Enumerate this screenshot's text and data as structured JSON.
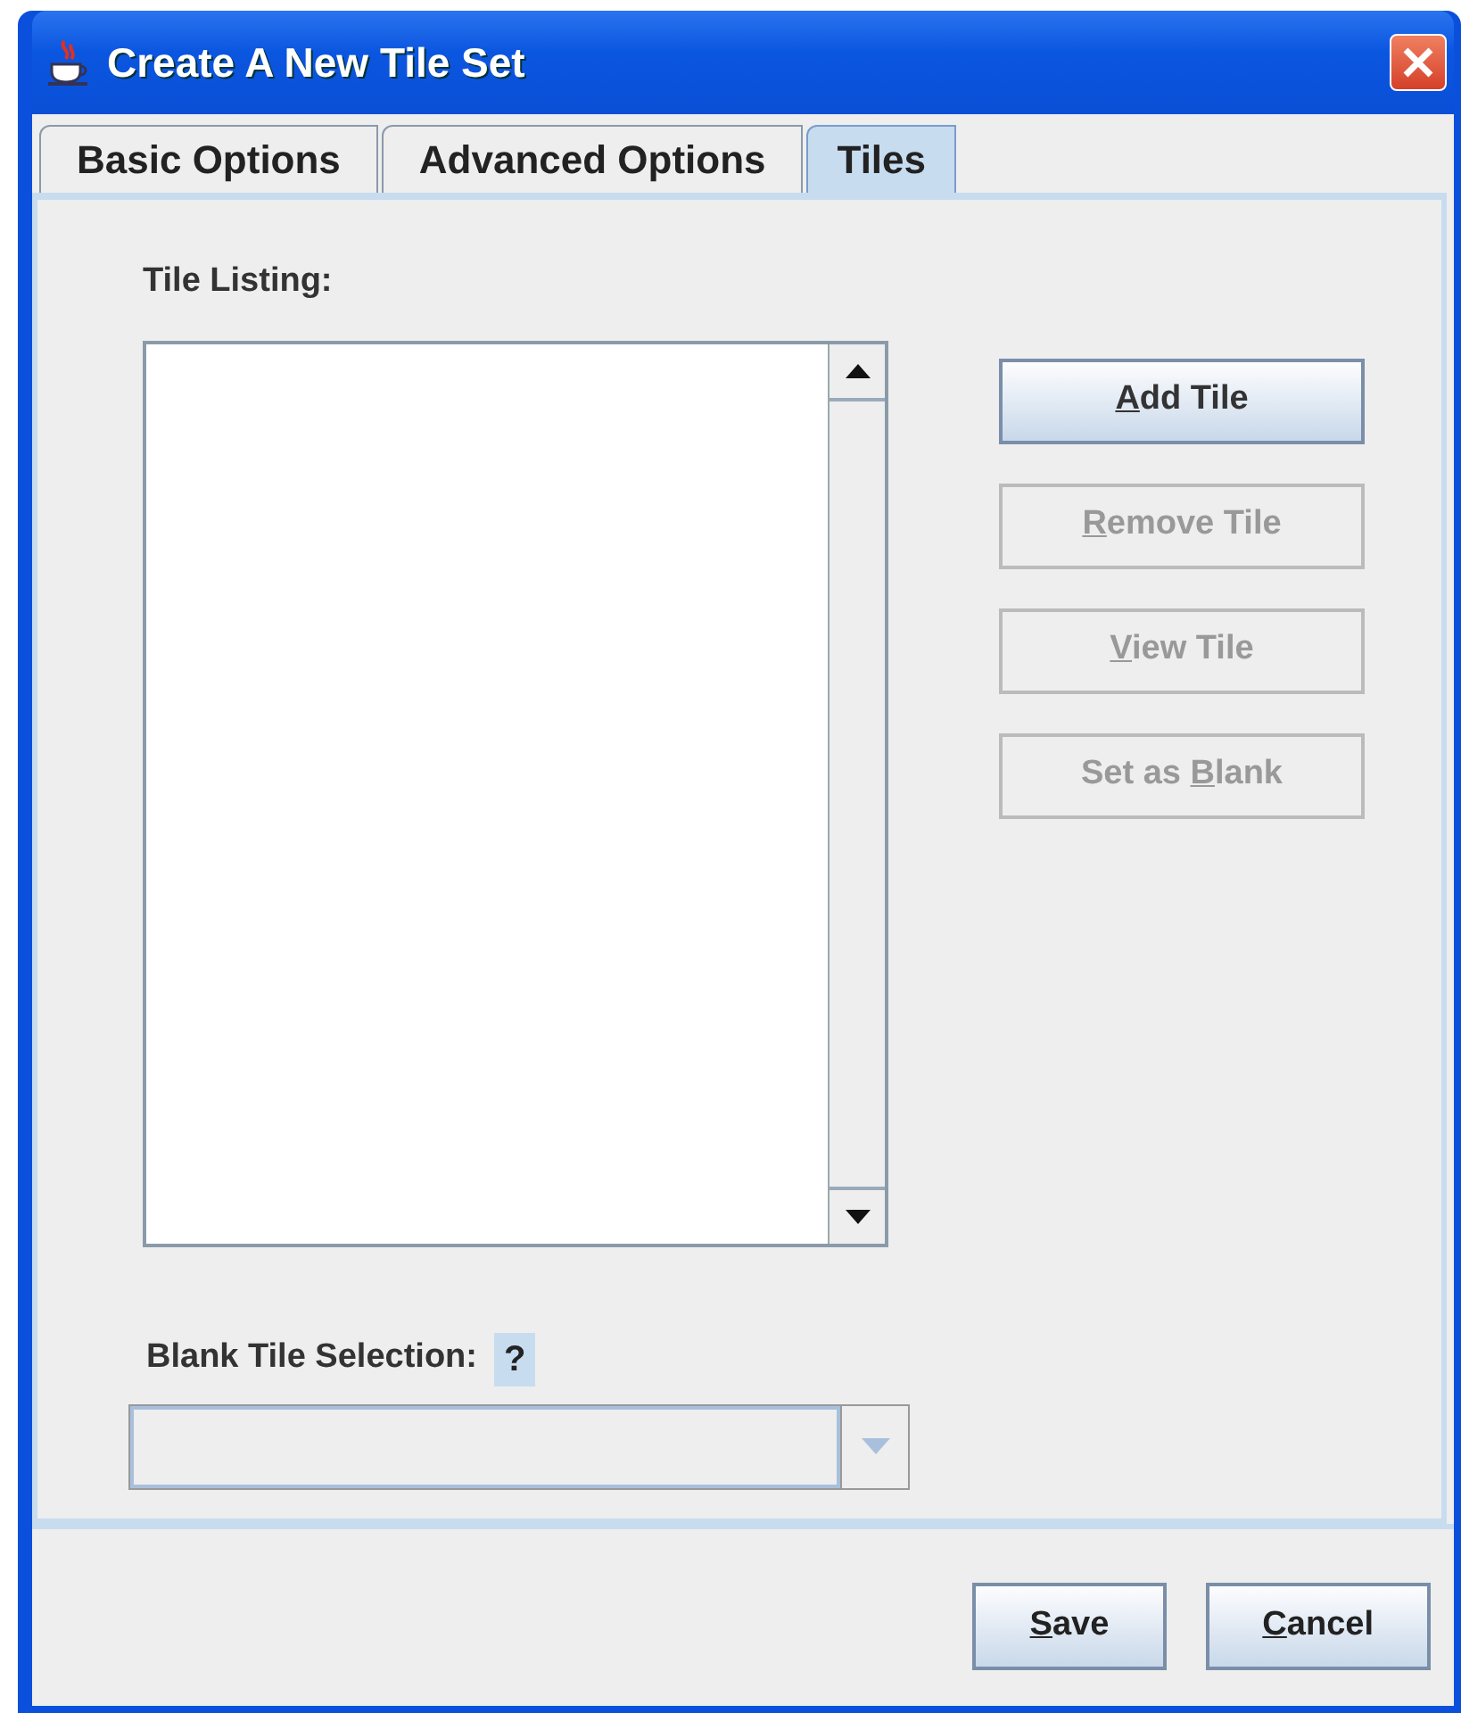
{
  "window": {
    "title": "Create A New Tile Set"
  },
  "tabs": [
    {
      "label": "Basic Options",
      "selected": false
    },
    {
      "label": "Advanced Options",
      "selected": false
    },
    {
      "label": "Tiles",
      "selected": true
    }
  ],
  "tile_listing": {
    "label": "Tile Listing:"
  },
  "side_buttons": [
    {
      "label": {
        "key": "A",
        "post": "dd Tile"
      },
      "disabled": false
    },
    {
      "label": {
        "key": "R",
        "post": "emove Tile"
      },
      "disabled": true
    },
    {
      "label": {
        "key": "V",
        "post": "iew Tile"
      },
      "disabled": true
    },
    {
      "label": {
        "pre": "Set as ",
        "key": "B",
        "post": "lank"
      },
      "disabled": true
    }
  ],
  "blank_tile": {
    "label": "Blank Tile Selection:",
    "help": "?",
    "disabled": true
  },
  "footer_buttons": [
    {
      "label": {
        "key": "S",
        "post": "ave"
      }
    },
    {
      "label": {
        "key": "C",
        "post": "ancel"
      }
    }
  ]
}
